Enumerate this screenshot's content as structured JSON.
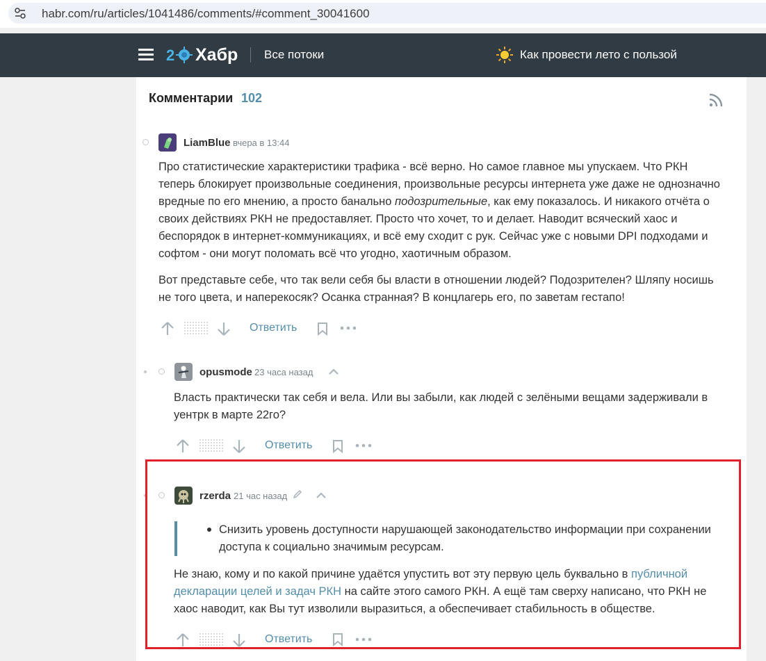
{
  "browser": {
    "url": "habr.com/ru/articles/1041486/comments/#comment_30041600"
  },
  "header": {
    "logo_text": "Хабр",
    "streams_label": "Все потоки",
    "promo_label": "Как провести лето с пользой"
  },
  "comments": {
    "title": "Комментарии",
    "count": "102",
    "items": [
      {
        "username": "LiamBlue",
        "time": "вчера в 13:44",
        "p1_lines": [
          "Про статистические характеристики трафика - всё верно. Но самое главное мы упускаем. Что РКН",
          "теперь блокирует произвольные соединения, произвольные ресурсы интернета уже даже не однозначно",
          "вредные по его мнению, а просто банально ",
          "подозрительные",
          ", как ему показалось. И никакого отчёта о",
          "своих действиях РКН не предоставляет. Просто что хочет, то и делает. Наводит всяческий хаос и",
          "беспорядок в интернет-коммуникациях, и всё ему сходит с рук. Сейчас уже с новыми DPI подходами и",
          "софтом - они могут поломать всё что угодно, хаотичным образом."
        ],
        "p2_lines": [
          "Вот представьте себе, что так вели себя бы власти в отношении людей? Подозрителен? Шляпу носишь",
          "не того цвета, и наперекосяк? Осанка странная? В концлагерь его, по заветам гестапо!"
        ],
        "reply_label": "Ответить"
      },
      {
        "username": "opusmode",
        "time": "23 часа назад",
        "lines": [
          "Власть практически так себя и вела. Или вы забыли, как людей с зелёными вещами задерживали в",
          "уентрк в марте 22го?"
        ],
        "reply_label": "Ответить"
      },
      {
        "username": "rzerda",
        "time": "21 час назад",
        "quote_lines": [
          "Снизить уровень доступности нарушающей законодательство информации при сохранении",
          "доступа к социально значимым ресурсам."
        ],
        "line1_a": "Не знаю, кому и по какой причине удаётся упустить вот эту первую цель буквально в ",
        "line1_link": "публичной",
        "line2_link": "декларации целей и задач РКН",
        "line2_b": " на сайте этого самого РКН. А ещё там сверху написано, что РКН не",
        "line3": "хаос наводит, как Вы тут изволили выразиться, а обеспечивает стабильность в обществе.",
        "reply_label": "Ответить"
      }
    ]
  },
  "colors": {
    "header_bg": "#303b44",
    "accent": "#548eaa",
    "highlight": "#e0202a"
  }
}
